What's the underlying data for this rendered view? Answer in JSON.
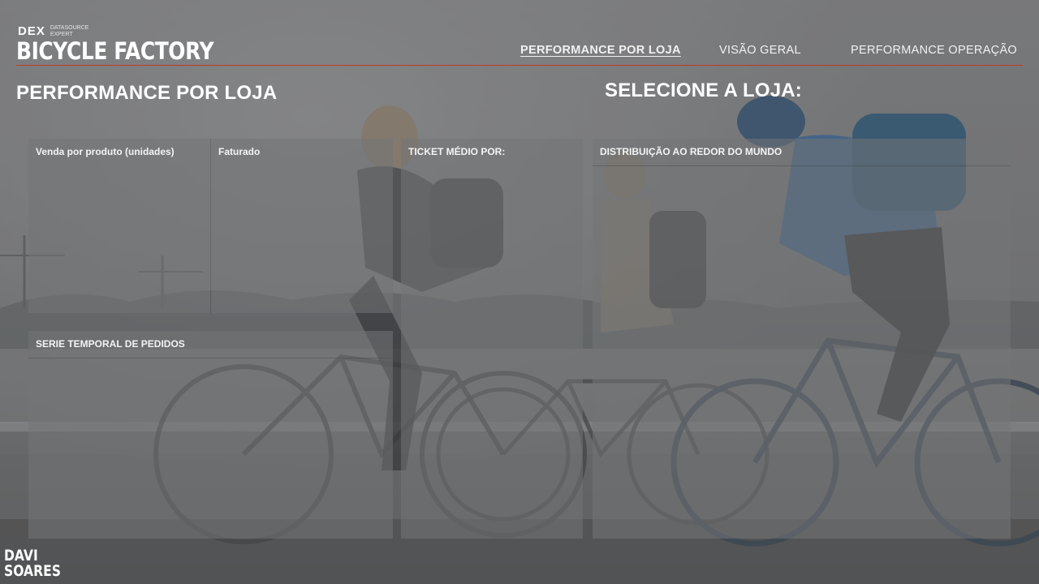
{
  "header": {
    "logo_mark": "DEX",
    "logo_sub_line1": "DATASOURCE",
    "logo_sub_line2": "EXPERT",
    "brand_title": "BICYCLE FACTORY"
  },
  "nav": {
    "items": [
      {
        "label": "PERFORMANCE POR LOJA",
        "active": true
      },
      {
        "label": "VISÃO GERAL",
        "active": false
      },
      {
        "label": "PERFORMANCE OPERAÇÃO",
        "active": false
      }
    ]
  },
  "page": {
    "title": "PERFORMANCE POR LOJA",
    "store_selector_label": "SELECIONE A LOJA:"
  },
  "panels": {
    "sales_by_product": "Venda por produto (unidades)",
    "revenue": "Faturado",
    "avg_ticket": "TICKET MÉDIO POR:",
    "world_distribution": "DISTRIBUIÇÃO AO REDOR DO MUNDO",
    "orders_timeseries": "SERIE TEMPORAL DE PEDIDOS"
  },
  "footer": {
    "signature_line1": "DAVI",
    "signature_line2": "SOARES"
  },
  "colors": {
    "accent_line": "#c0392b",
    "panel_overlay": "rgba(115,116,118,0.55)"
  }
}
